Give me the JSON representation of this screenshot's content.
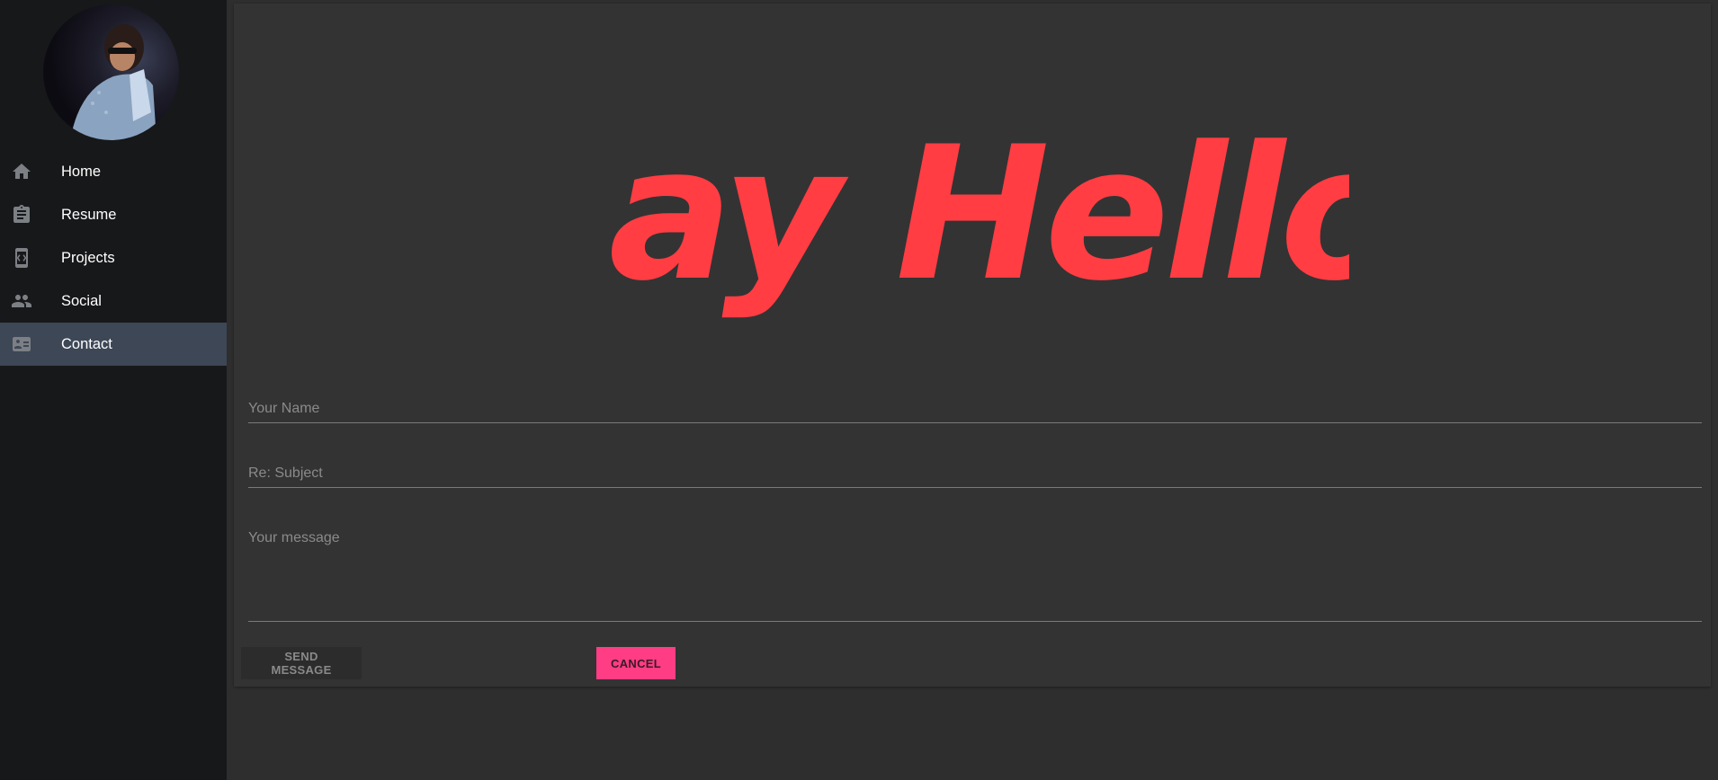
{
  "sidebar": {
    "nav": [
      {
        "label": "Home",
        "icon": "home-icon"
      },
      {
        "label": "Resume",
        "icon": "clipboard-icon"
      },
      {
        "label": "Projects",
        "icon": "code-device-icon"
      },
      {
        "label": "Social",
        "icon": "people-icon"
      },
      {
        "label": "Contact",
        "icon": "contact-card-icon",
        "active": true
      }
    ]
  },
  "main": {
    "hero_text": "Say Hello!",
    "form": {
      "name_placeholder": "Your Name",
      "subject_placeholder": "Re: Subject",
      "message_placeholder": "Your message",
      "send_label": "SEND MESSAGE",
      "cancel_label": "CANCEL"
    }
  },
  "colors": {
    "sidebar_bg": "#17181a",
    "active_nav": "#3d4756",
    "hero_red": "#ff3d43",
    "cancel_pink": "#ff3d84"
  }
}
